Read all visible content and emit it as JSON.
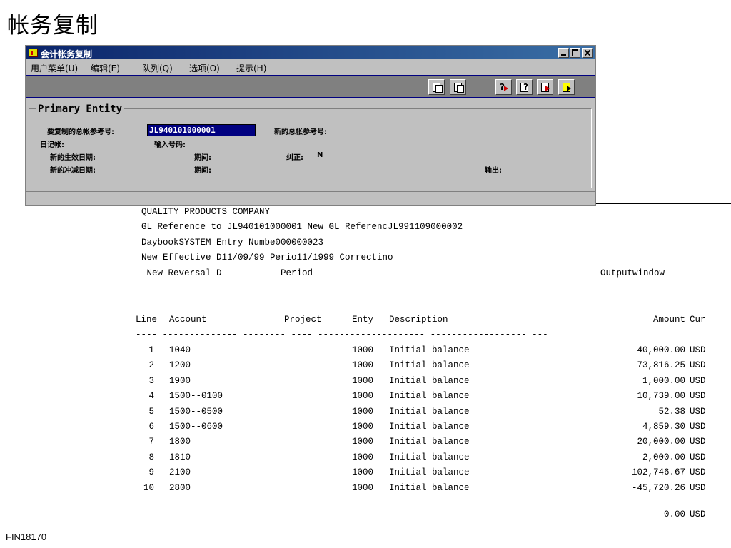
{
  "slide": {
    "title": "帐务复制",
    "footer_code": "FIN18170"
  },
  "window": {
    "title": "会计帐务复制",
    "menu": [
      "用户菜单(U)",
      "编辑(E)",
      "队列(Q)",
      "选项(O)",
      "提示(H)"
    ],
    "toolbar_icons": [
      "copy-icon",
      "paste-icon",
      "query-icon",
      "help-icon",
      "export-icon",
      "exit-icon"
    ],
    "group_title": "Primary Entity",
    "fields": {
      "copy_ref_label": "要复制的总帐参考号:",
      "copy_ref_value": "JL940101000001",
      "new_ref_label": "新的总帐参考号:",
      "daybook_label": "日记帐:",
      "entry_no_label": "输入号码:",
      "new_effective_date_label": "新的生效日期:",
      "period_label_1": "期间:",
      "correction_label": "纠正:",
      "correction_value": "N",
      "new_reversal_date_label": "新的冲减日期:",
      "period_label_2": "期间:",
      "output_label": "输出:"
    }
  },
  "report": {
    "header_lines": [
      "QUALITY PRODUCTS COMPANY",
      "GL Reference to JL940101000001 New GL ReferencJL991109000002",
      "DaybookSYSTEM    Entry Numbe000000023",
      "New Effective D11/09/99 Perio11/1999   Correctino",
      " New Reversal D           Period"
    ],
    "output_window": "Outputwindow",
    "columns": {
      "line": "Line",
      "account": "Account",
      "project": "Project",
      "enty": "Enty",
      "description": "Description",
      "amount": "Amount",
      "cur": "Cur"
    },
    "dash_line": "---- -------------- -------- ---- -------------------- ------------------ ---",
    "rows": [
      {
        "line": "1",
        "account": "1040",
        "enty": "1000",
        "description": "Initial balance",
        "amount": "40,000.00",
        "cur": "USD"
      },
      {
        "line": "2",
        "account": "1200",
        "enty": "1000",
        "description": "Initial balance",
        "amount": "73,816.25",
        "cur": "USD"
      },
      {
        "line": "3",
        "account": "1900",
        "enty": "1000",
        "description": "Initial balance",
        "amount": "1,000.00",
        "cur": "USD"
      },
      {
        "line": "4",
        "account": "1500--0100",
        "enty": "1000",
        "description": "Initial balance",
        "amount": "10,739.00",
        "cur": "USD"
      },
      {
        "line": "5",
        "account": "1500--0500",
        "enty": "1000",
        "description": "Initial balance",
        "amount": "52.38",
        "cur": "USD"
      },
      {
        "line": "6",
        "account": "1500--0600",
        "enty": "1000",
        "description": "Initial balance",
        "amount": "4,859.30",
        "cur": "USD"
      },
      {
        "line": "7",
        "account": "1800",
        "enty": "1000",
        "description": "Initial balance",
        "amount": "20,000.00",
        "cur": "USD"
      },
      {
        "line": "8",
        "account": "1810",
        "enty": "1000",
        "description": "Initial balance",
        "amount": "-2,000.00",
        "cur": "USD"
      },
      {
        "line": "9",
        "account": "2100",
        "enty": "1000",
        "description": "Initial balance",
        "amount": "-102,746.67",
        "cur": "USD"
      },
      {
        "line": "10",
        "account": "2800",
        "enty": "1000",
        "description": "Initial balance",
        "amount": "-45,720.26",
        "cur": "USD"
      }
    ],
    "total_dashes": "------------------",
    "total_amount": "0.00",
    "total_cur": "USD"
  }
}
